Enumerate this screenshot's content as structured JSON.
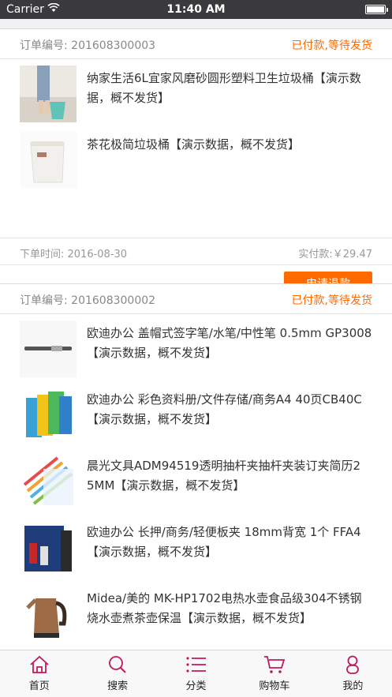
{
  "status_bar": {
    "carrier": "Carrier",
    "time": "11:40 AM"
  },
  "accent_color": "#ff6a00",
  "tab_icon_color": "#c0195c",
  "orders": [
    {
      "order_no": "订单编号: 201608300003",
      "status": "已付款,等待发货",
      "items": [
        {
          "title": "纳家生活6L宜家风磨砂圆形塑料卫生垃圾桶【演示数据，概不发货】"
        },
        {
          "title": "茶花极简垃圾桶【演示数据，概不发货】"
        }
      ],
      "order_time": "下单时间: 2016-08-30",
      "paid": "实付款:￥29.47",
      "refund_label": "申请退款"
    },
    {
      "order_no": "订单编号: 201608300002",
      "status": "已付款,等待发货",
      "items": [
        {
          "title": "欧迪办公 盖帽式签字笔/水笔/中性笔 0.5mm GP3008【演示数据，概不发货】"
        },
        {
          "title": "欧迪办公 彩色资料册/文件存储/商务A4 40页CB40C【演示数据，概不发货】"
        },
        {
          "title": "晨光文具ADM94519透明抽杆夹抽杆夹装订夹简历2 5MM【演示数据，概不发货】"
        },
        {
          "title": "欧迪办公 长押/商务/轻便板夹 18mm背宽 1个 FFA4【演示数据，概不发货】"
        },
        {
          "title": "Midea/美的 MK-HP1702电热水壶食品级304不锈钢烧水壶煮茶壶保温【演示数据，概不发货】"
        }
      ]
    }
  ],
  "tabbar": [
    {
      "label": "首页",
      "icon": "home-icon"
    },
    {
      "label": "搜索",
      "icon": "search-icon"
    },
    {
      "label": "分类",
      "icon": "list-icon"
    },
    {
      "label": "购物车",
      "icon": "cart-icon"
    },
    {
      "label": "我的",
      "icon": "user-icon"
    }
  ]
}
